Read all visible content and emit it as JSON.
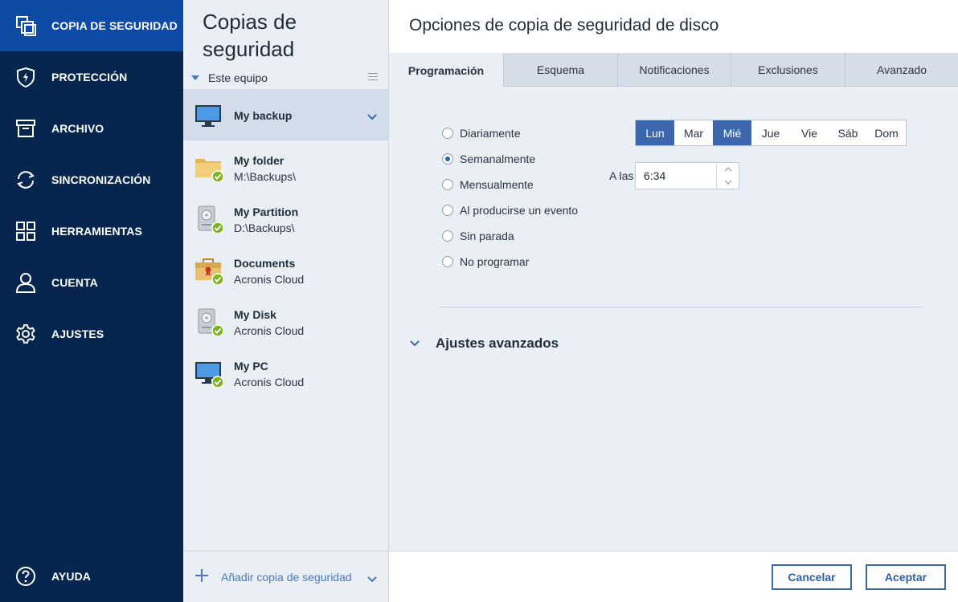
{
  "nav": {
    "items": [
      {
        "label": "COPIA DE SEGURIDAD",
        "icon": "backup-copy-icon",
        "active": true
      },
      {
        "label": "PROTECCIÓN",
        "icon": "shield-icon"
      },
      {
        "label": "ARCHIVO",
        "icon": "archive-box-icon"
      },
      {
        "label": "SINCRONIZACIÓN",
        "icon": "sync-icon"
      },
      {
        "label": "HERRAMIENTAS",
        "icon": "grid-icon"
      },
      {
        "label": "CUENTA",
        "icon": "user-icon"
      },
      {
        "label": "AJUSTES",
        "icon": "gear-icon"
      }
    ],
    "help": {
      "label": "AYUDA",
      "icon": "help-icon"
    }
  },
  "list": {
    "title": "Copias de seguridad",
    "filter": "Este equipo",
    "backups": [
      {
        "name": "My backup",
        "sub": "",
        "icon": "monitor-icon",
        "selected": true
      },
      {
        "name": "My folder",
        "sub": "M:\\Backups\\",
        "icon": "folder-icon"
      },
      {
        "name": "My Partition",
        "sub": "D:\\Backups\\",
        "icon": "disk-icon"
      },
      {
        "name": "Documents",
        "sub": "Acronis Cloud",
        "icon": "briefcase-icon"
      },
      {
        "name": "My Disk",
        "sub": "Acronis Cloud",
        "icon": "disk-icon"
      },
      {
        "name": "My PC",
        "sub": "Acronis Cloud",
        "icon": "monitor-icon"
      }
    ],
    "add_label": "Añadir copia de seguridad"
  },
  "panel": {
    "title": "Opciones de copia de seguridad de disco",
    "tabs": [
      "Programación",
      "Esquema",
      "Notificaciones",
      "Exclusiones",
      "Avanzado"
    ],
    "active_tab": "Programación",
    "schedule_options": [
      "Diariamente",
      "Semanalmente",
      "Mensualmente",
      "Al producirse un evento",
      "Sin parada",
      "No programar"
    ],
    "selected_option": "Semanalmente",
    "days": [
      "Lun",
      "Mar",
      "Mié",
      "Jue",
      "Vie",
      "Sáb",
      "Dom"
    ],
    "selected_days": [
      "Lun",
      "Mié"
    ],
    "at_label": "A las",
    "time": "6:34",
    "advanced_label": "Ajustes avanzados",
    "cancel_label": "Cancelar",
    "accept_label": "Aceptar"
  },
  "colors": {
    "nav_bg": "#06254f",
    "nav_active": "#0d4ba6",
    "accent": "#3a67ad",
    "panel_bg": "#eaeef5",
    "check_green": "#7ab51d"
  }
}
